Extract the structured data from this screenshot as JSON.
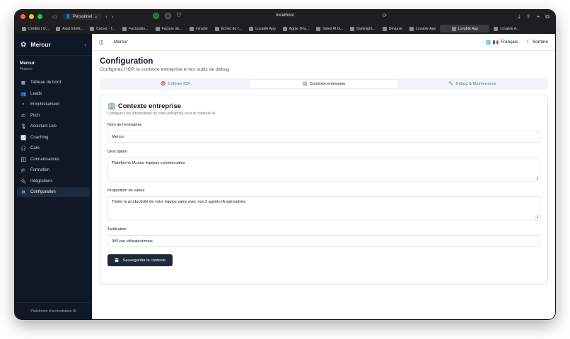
{
  "browser": {
    "url": "localhost",
    "profile": "Personnel",
    "bookmarks": [
      {
        "label": "Credits | O..."
      },
      {
        "label": "Axial Intelli..."
      },
      {
        "label": "Cursor - T..."
      },
      {
        "label": "Facturatio..."
      },
      {
        "label": "Facture de..."
      },
      {
        "label": "miradie"
      },
      {
        "label": "Échec de l'..."
      },
      {
        "label": "Lovable App"
      },
      {
        "label": "Apple (Fra..."
      },
      {
        "label": "Sales AI G..."
      },
      {
        "label": "Darknight..."
      },
      {
        "label": "Devpost"
      },
      {
        "label": "Lovable App"
      },
      {
        "label": "Lovable App",
        "active": true
      },
      {
        "label": "Lovable A..."
      }
    ]
  },
  "sidebar": {
    "brand": "Mercur",
    "org_name": "Mercur",
    "org_sub": "Finance",
    "items": [
      {
        "label": "Tableau de bord",
        "icon": "dashboard-icon",
        "glyph": "▦"
      },
      {
        "label": "Leads",
        "icon": "users-icon",
        "glyph": "👥"
      },
      {
        "label": "Enrichissement",
        "icon": "search-icon",
        "glyph": "⌕"
      },
      {
        "label": "Pitch",
        "icon": "phone-icon",
        "glyph": "✆"
      },
      {
        "label": "Assistant Live",
        "icon": "microphone-icon",
        "glyph": "🎙"
      },
      {
        "label": "Coaching",
        "icon": "chart-icon",
        "glyph": "📈"
      },
      {
        "label": "Care",
        "icon": "headphones-icon",
        "glyph": "🎧"
      },
      {
        "label": "Connaissances",
        "icon": "database-icon",
        "glyph": "🗄"
      },
      {
        "label": "Formation",
        "icon": "graduation-cap-icon",
        "glyph": "🎓"
      },
      {
        "label": "Intégrations",
        "icon": "plug-icon",
        "glyph": "🔌"
      },
      {
        "label": "Configuration",
        "icon": "gear-icon",
        "glyph": "⚙",
        "active": true
      }
    ],
    "footer": "Plateforme d'orchestration IA"
  },
  "topbar": {
    "breadcrumb": "Mercur",
    "language": "Français",
    "theme": "Sombre"
  },
  "page": {
    "title": "Configuration",
    "subtitle": "Configurez l'ICP, le contexte entreprise et les outils de debug"
  },
  "tabs": [
    {
      "label": "Critères ICP",
      "icon": "target-icon",
      "glyph": "🎯"
    },
    {
      "label": "Contexte entreprise",
      "icon": "building-icon",
      "glyph": "🏢",
      "active": true
    },
    {
      "label": "Debug & Maintenance",
      "icon": "wrench-icon",
      "glyph": "🔧"
    }
  ],
  "form": {
    "title": "Contexte entreprise",
    "subtitle": "Configurez les informations de votre entreprise pour le contexte IA",
    "company_label": "Nom de l'entreprise",
    "company_value": "Mercur",
    "description_label": "Description",
    "description_value": "Plateforme IA pour équipes commerciales",
    "value_prop_label": "Proposition de valeur",
    "value_prop_value": "Tripler la productivité de votre équipe sales avec nos 3 agents IA spécialisés.",
    "pricing_label": "Tarification",
    "pricing_value": "99€ par utilisateur/mois",
    "save_label": "Sauvegarder le contexte"
  },
  "colors": {
    "sidebar_bg": "#101828",
    "button_bg": "#1e293b",
    "accent": "#0f172a"
  }
}
